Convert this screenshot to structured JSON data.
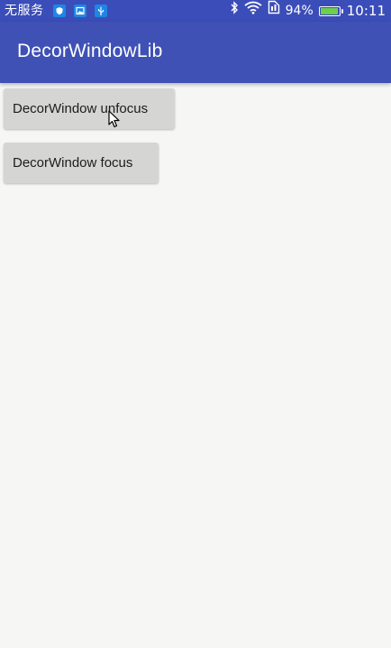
{
  "status_bar": {
    "carrier": "无服务",
    "battery_percent": "94%",
    "time": "10:11",
    "battery_level": 0.94,
    "icons": [
      "shield-notification-icon",
      "image-notification-icon",
      "usb-notification-icon",
      "bluetooth-icon",
      "wifi-icon",
      "sim-icon",
      "battery-icon"
    ]
  },
  "app_bar": {
    "title": "DecorWindowLib"
  },
  "buttons": {
    "unfocus_label": "DecorWindow unfocus",
    "focus_label": "DecorWindow focus"
  },
  "colors": {
    "primary": "#3f51b5",
    "status_bar": "#3b4db8",
    "background": "#f6f7f5",
    "button": "#d5d6d4"
  }
}
